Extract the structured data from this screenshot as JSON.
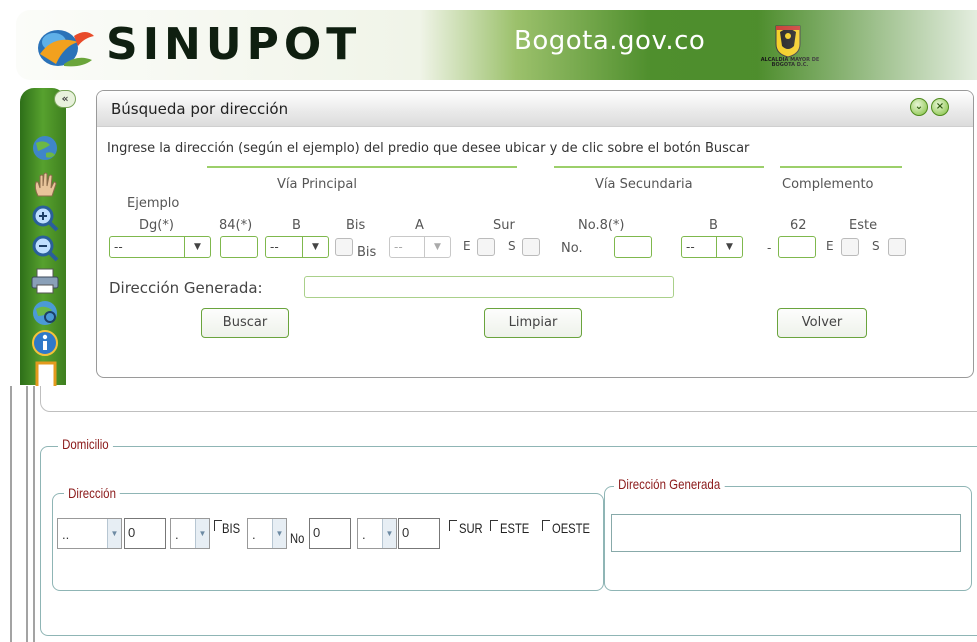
{
  "app": {
    "brand": "SINUPOT",
    "domain": "Bogota.gov.co",
    "shield_caption": "ALCALDIA MAYOR DE BOGOTA D.C.",
    "collapse_symbol": "«"
  },
  "panel": {
    "title": "Búsqueda por dirección",
    "instructions": "Ingrese la dirección (según el ejemplo) del predio que desee ubicar y de clic sobre el botón Buscar",
    "sections": {
      "principal": "Vía Principal",
      "secundaria": "Vía Secundaria",
      "complemento": "Complemento"
    },
    "example_label": "Ejemplo",
    "example_values": [
      "Dg(*)",
      "84(*)",
      "B",
      "Bis",
      "A",
      "Sur",
      "No.8(*)",
      "B",
      "62",
      "Este"
    ],
    "fields": {
      "tipo_via_value": "--",
      "letra1_value": "--",
      "letra2_value": "--",
      "letra3_value": "--",
      "bis_label": "Bis",
      "no_label": "No.",
      "e_label": "E",
      "s_label": "S",
      "dash": "-"
    },
    "generated_label": "Dirección Generada:",
    "buttons": {
      "buscar": "Buscar",
      "limpiar": "Limpiar",
      "volver": "Volver"
    }
  },
  "form": {
    "domicilio_legend": "Domicilio",
    "direccion_legend": "Dirección",
    "generada_legend": "Dirección Generada",
    "select1_value": "..",
    "input1_value": "0",
    "select2_value": ".",
    "bis_label": "BIS",
    "select3_value": ".",
    "no_label": "No",
    "input2_value": "0",
    "select4_value": ".",
    "input3_value": "0",
    "sur_label": "SUR",
    "este_label": "ESTE",
    "oeste_label": "OESTE"
  },
  "icons": [
    "globe-icon",
    "hand-pan-icon",
    "zoom-in-icon",
    "zoom-out-icon",
    "print-icon",
    "globe-search-icon",
    "info-icon",
    "frame-icon"
  ],
  "colors": {
    "accent_green": "#4f8f2d",
    "legend_red": "#8b1a1a"
  }
}
